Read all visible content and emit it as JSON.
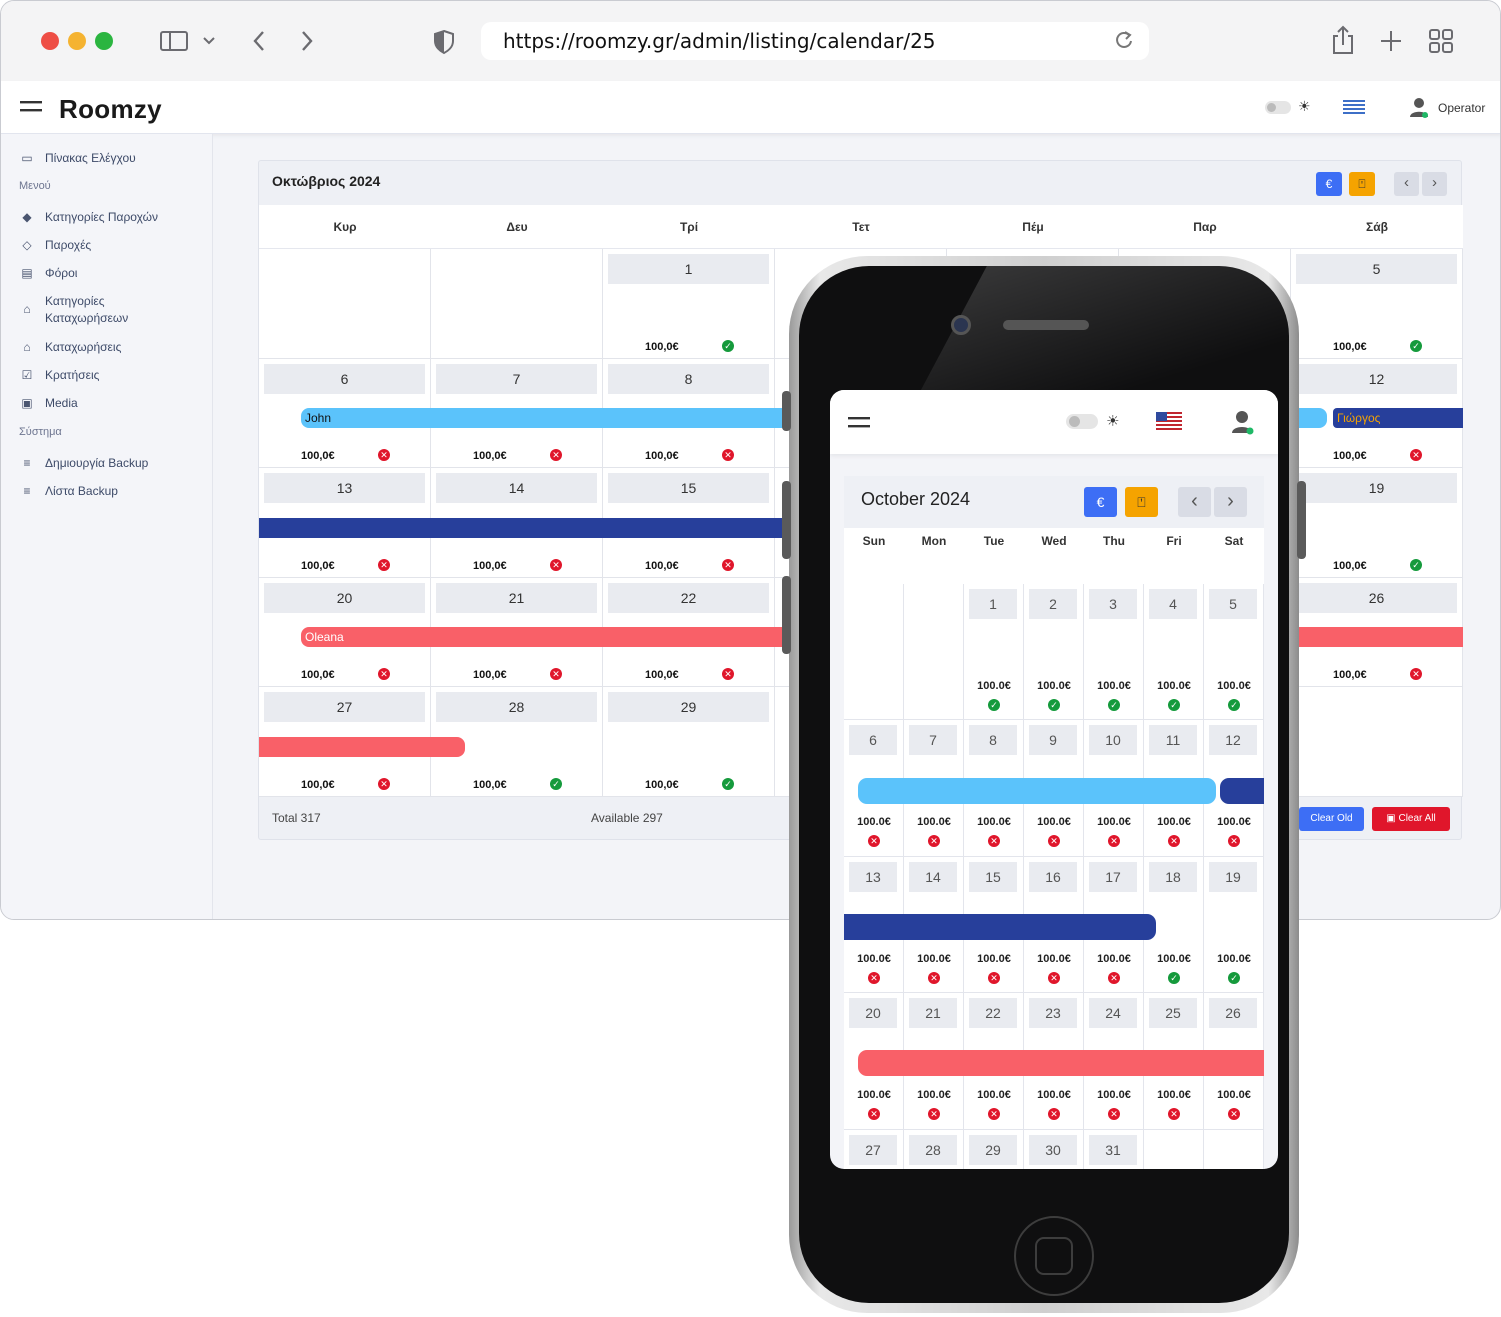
{
  "browser": {
    "url": "https://roomzy.gr/admin/listing/calendar/25",
    "icons": [
      "sidebar-toggle-icon",
      "chevron-down-icon",
      "back-icon",
      "forward-icon",
      "shield-icon",
      "reload-icon",
      "share-icon",
      "plus-icon",
      "tabs-grid-icon"
    ],
    "traffic_colors": [
      "#ee4e45",
      "#f5b331",
      "#2bb540"
    ]
  },
  "app": {
    "title": "Roomzy",
    "user": "Operator"
  },
  "sidebar": {
    "dashboard": "Πίνακας Ελέγχου",
    "menu_section": "Μενού",
    "items": [
      {
        "label": "Κατηγορίες Παροχών",
        "icon": "tag-icon"
      },
      {
        "label": "Παροχές",
        "icon": "tag-outline-icon"
      },
      {
        "label": "Φόροι",
        "icon": "list-icon"
      },
      {
        "label": "Κατηγορίες",
        "label2": "Καταχωρήσεων",
        "icon": "categories-icon"
      },
      {
        "label": "Καταχωρήσεις",
        "icon": "home-icon"
      },
      {
        "label": "Κρατήσεις",
        "icon": "calendar-check-icon"
      },
      {
        "label": "Media",
        "icon": "image-icon"
      }
    ],
    "system_section": "Σύστημα",
    "system_items": [
      {
        "label": "Δημιουργία Backup",
        "icon": "database-icon"
      },
      {
        "label": "Λίστα Backup",
        "icon": "database-icon"
      }
    ]
  },
  "calendar": {
    "title": "Οκτώβριος 2024",
    "currency_btn": "€",
    "prev": "‹",
    "next": "›",
    "days": [
      "Κυρ",
      "Δευ",
      "Τρί",
      "Τετ",
      "Πέμ",
      "Παρ",
      "Σάβ"
    ],
    "weeks": [
      [
        null,
        null,
        {
          "d": "1",
          "p": "100,0€",
          "s": "ok"
        },
        null,
        null,
        null,
        {
          "d": "5",
          "p": "100,0€",
          "s": "ok"
        }
      ],
      [
        {
          "d": "6",
          "p": "100,0€",
          "s": "no"
        },
        {
          "d": "7",
          "p": "100,0€",
          "s": "no"
        },
        {
          "d": "8",
          "p": "100,0€",
          "s": "no"
        },
        null,
        null,
        null,
        {
          "d": "12",
          "p": "100,0€",
          "s": "no"
        }
      ],
      [
        {
          "d": "13",
          "p": "100,0€",
          "s": "no"
        },
        {
          "d": "14",
          "p": "100,0€",
          "s": "no"
        },
        {
          "d": "15",
          "p": "100,0€",
          "s": "no"
        },
        null,
        null,
        null,
        {
          "d": "19",
          "p": "100,0€",
          "s": "ok"
        }
      ],
      [
        {
          "d": "20",
          "p": "100,0€",
          "s": "no"
        },
        {
          "d": "21",
          "p": "100,0€",
          "s": "no"
        },
        {
          "d": "22",
          "p": "100,0€",
          "s": "no"
        },
        null,
        null,
        null,
        {
          "d": "26",
          "p": "100,0€",
          "s": "no"
        }
      ],
      [
        {
          "d": "27",
          "p": "100,0€",
          "s": "no"
        },
        {
          "d": "28",
          "p": "100,0€",
          "s": "ok"
        },
        {
          "d": "29",
          "p": "100,0€",
          "s": "ok"
        },
        null,
        null,
        null,
        null
      ]
    ],
    "bookings": {
      "john": "John",
      "giorgos": "Γιώργος",
      "oleana": "Oleana"
    },
    "colors": {
      "light_blue": "#5bc3fb",
      "navy": "#273f9b",
      "red": "#f96068",
      "primary": "#3d6ef5",
      "orange": "#f5a300",
      "danger": "#e0162b"
    },
    "total": "Total 317",
    "available": "Available 297",
    "clear_old": "Clear Old",
    "clear_all": "Clear All"
  },
  "mobile": {
    "title": "October 2024",
    "currency_btn": "€",
    "prev": "‹",
    "next": "›",
    "days": [
      "Sun",
      "Mon",
      "Tue",
      "Wed",
      "Thu",
      "Fri",
      "Sat"
    ],
    "weeks": [
      [
        null,
        null,
        {
          "d": "1",
          "s": "ok"
        },
        {
          "d": "2",
          "s": "ok"
        },
        {
          "d": "3",
          "s": "ok"
        },
        {
          "d": "4",
          "s": "ok"
        },
        {
          "d": "5",
          "s": "ok"
        }
      ],
      [
        {
          "d": "6",
          "s": "no"
        },
        {
          "d": "7",
          "s": "no"
        },
        {
          "d": "8",
          "s": "no"
        },
        {
          "d": "9",
          "s": "no"
        },
        {
          "d": "10",
          "s": "no"
        },
        {
          "d": "11",
          "s": "no"
        },
        {
          "d": "12",
          "s": "no"
        }
      ],
      [
        {
          "d": "13",
          "s": "no"
        },
        {
          "d": "14",
          "s": "no"
        },
        {
          "d": "15",
          "s": "no"
        },
        {
          "d": "16",
          "s": "no"
        },
        {
          "d": "17",
          "s": "no"
        },
        {
          "d": "18",
          "s": "ok"
        },
        {
          "d": "19",
          "s": "ok"
        }
      ],
      [
        {
          "d": "20",
          "s": "no"
        },
        {
          "d": "21",
          "s": "no"
        },
        {
          "d": "22",
          "s": "no"
        },
        {
          "d": "23",
          "s": "no"
        },
        {
          "d": "24",
          "s": "no"
        },
        {
          "d": "25",
          "s": "no"
        },
        {
          "d": "26",
          "s": "no"
        }
      ],
      [
        {
          "d": "27"
        },
        {
          "d": "28"
        },
        {
          "d": "29"
        },
        {
          "d": "30"
        },
        {
          "d": "31"
        },
        null,
        null
      ]
    ],
    "price": "100.0€"
  }
}
